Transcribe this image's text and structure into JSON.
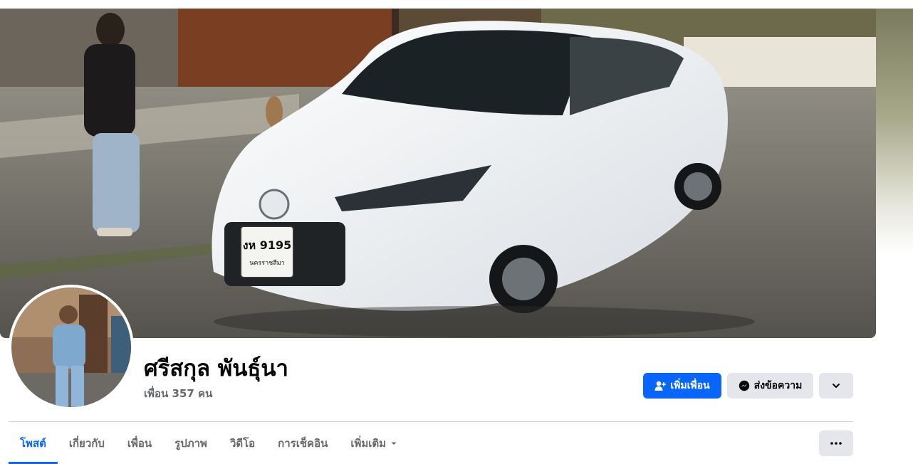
{
  "cover": {
    "description_icon": "cover-photo"
  },
  "profile": {
    "name": "ศรีสกุล พันธุ์นา",
    "friends_text": "เพื่อน 357 คน"
  },
  "actions": {
    "add_friend_label": "เพิ่มเพื่อน",
    "message_label": "ส่งข้อความ",
    "more_icon": "chevron-down-icon"
  },
  "tabs": [
    {
      "label": "โพสต์",
      "active": true
    },
    {
      "label": "เกี่ยวกับ",
      "active": false
    },
    {
      "label": "เพื่อน",
      "active": false
    },
    {
      "label": "รูปภาพ",
      "active": false
    },
    {
      "label": "วิดีโอ",
      "active": false
    },
    {
      "label": "การเช็คอิน",
      "active": false
    },
    {
      "label": "เพิ่มเติม",
      "active": false
    }
  ],
  "plate": {
    "line1": "งห 9195",
    "line2": "นครราชสีมา"
  },
  "colors": {
    "accent": "#0866ff",
    "secondary_button": "#e4e6eb",
    "muted_text": "#65676b"
  }
}
